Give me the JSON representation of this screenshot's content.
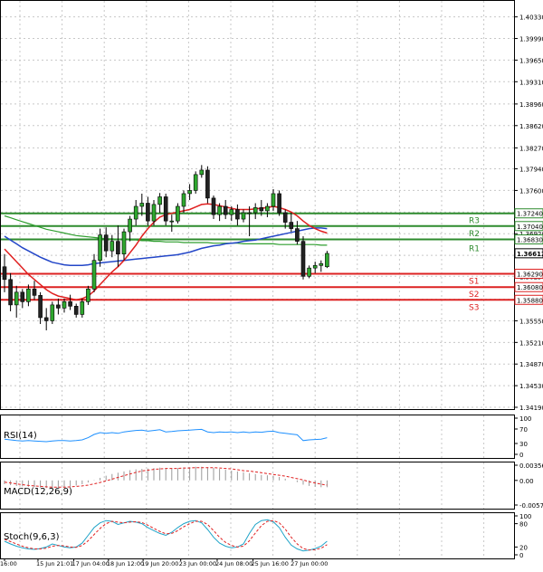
{
  "chart_data": {
    "type": "candlestick",
    "main_panel": {
      "price_axis_labels": [
        "1.40330",
        "1.39990",
        "1.39650",
        "1.39310",
        "1.38960",
        "1.38620",
        "1.38270",
        "1.37940",
        "1.37600",
        "1.37260",
        "1.36920",
        "1.36580",
        "1.36250",
        "1.35890",
        "1.35550",
        "1.35210",
        "1.34870",
        "1.34530",
        "1.34190"
      ],
      "price_axis_values": [
        1.4033,
        1.3999,
        1.3965,
        1.3931,
        1.3896,
        1.3862,
        1.3827,
        1.3794,
        1.376,
        1.3726,
        1.3692,
        1.3658,
        1.3625,
        1.3589,
        1.3555,
        1.3521,
        1.3487,
        1.3453,
        1.3419
      ],
      "ylim": [
        1.3419,
        1.4051
      ],
      "levels": [
        {
          "name": "R3",
          "value": 1.3724,
          "tag": "1.37240",
          "color": "#2e8b2e"
        },
        {
          "name": "R2",
          "value": 1.3704,
          "tag": "1.37040",
          "color": "#2e8b2e"
        },
        {
          "name": "",
          "value": 1.3683,
          "tag": "1.36830",
          "color": "#2e8b2e"
        },
        {
          "name": "R1",
          "value": 1.3683,
          "tag": "",
          "color": "#2e8b2e"
        },
        {
          "name": "S1",
          "value": 1.3629,
          "tag": "1.36290",
          "color": "#dd2222"
        },
        {
          "name": "S2",
          "value": 1.3608,
          "tag": "1.36080",
          "color": "#dd2222"
        },
        {
          "name": "S3",
          "value": 1.3588,
          "tag": "1.35880",
          "color": "#dd2222"
        }
      ],
      "current_price_tag": "1.36612",
      "current_price": 1.36612,
      "candles": [
        [
          1.364,
          1.366,
          1.36,
          1.362
        ],
        [
          1.362,
          1.363,
          1.357,
          1.358
        ],
        [
          1.358,
          1.361,
          1.356,
          1.36
        ],
        [
          1.36,
          1.3605,
          1.3575,
          1.3585
        ],
        [
          1.3585,
          1.3612,
          1.3578,
          1.3605
        ],
        [
          1.3605,
          1.3618,
          1.3588,
          1.3595
        ],
        [
          1.3595,
          1.36,
          1.355,
          1.356
        ],
        [
          1.356,
          1.3575,
          1.354,
          1.3555
        ],
        [
          1.3555,
          1.3585,
          1.355,
          1.358
        ],
        [
          1.358,
          1.359,
          1.3565,
          1.3575
        ],
        [
          1.3575,
          1.359,
          1.3568,
          1.3585
        ],
        [
          1.3585,
          1.3596,
          1.3572,
          1.3578
        ],
        [
          1.3578,
          1.3582,
          1.356,
          1.3565
        ],
        [
          1.3565,
          1.359,
          1.356,
          1.3585
        ],
        [
          1.3585,
          1.361,
          1.358,
          1.3605
        ],
        [
          1.3605,
          1.366,
          1.36,
          1.365
        ],
        [
          1.365,
          1.37,
          1.364,
          1.369
        ],
        [
          1.369,
          1.3702,
          1.3655,
          1.3665
        ],
        [
          1.3665,
          1.369,
          1.3655,
          1.368
        ],
        [
          1.368,
          1.3705,
          1.364,
          1.366
        ],
        [
          1.366,
          1.37,
          1.365,
          1.3695
        ],
        [
          1.3695,
          1.372,
          1.368,
          1.3715
        ],
        [
          1.3715,
          1.3745,
          1.3705,
          1.3735
        ],
        [
          1.3735,
          1.3755,
          1.372,
          1.374
        ],
        [
          1.374,
          1.375,
          1.3705,
          1.3712
        ],
        [
          1.3712,
          1.3745,
          1.3705,
          1.3738
        ],
        [
          1.3738,
          1.3756,
          1.3725,
          1.375
        ],
        [
          1.375,
          1.3755,
          1.3705,
          1.3712
        ],
        [
          1.3712,
          1.3722,
          1.3695,
          1.3712
        ],
        [
          1.3712,
          1.374,
          1.3708,
          1.3735
        ],
        [
          1.3735,
          1.376,
          1.3725,
          1.3755
        ],
        [
          1.3755,
          1.377,
          1.3745,
          1.376
        ],
        [
          1.376,
          1.379,
          1.3755,
          1.3785
        ],
        [
          1.3785,
          1.38,
          1.378,
          1.3792
        ],
        [
          1.3792,
          1.3798,
          1.374,
          1.3748
        ],
        [
          1.3748,
          1.3752,
          1.3715,
          1.3722
        ],
        [
          1.3722,
          1.374,
          1.3712,
          1.3735
        ],
        [
          1.3735,
          1.3745,
          1.3715,
          1.3722
        ],
        [
          1.3722,
          1.3735,
          1.3712,
          1.373
        ],
        [
          1.373,
          1.3738,
          1.3705,
          1.3715
        ],
        [
          1.3715,
          1.373,
          1.371,
          1.3725
        ],
        [
          1.3725,
          1.3735,
          1.3688,
          1.3725
        ],
        [
          1.3725,
          1.374,
          1.3715,
          1.3733
        ],
        [
          1.3733,
          1.3745,
          1.372,
          1.3728
        ],
        [
          1.3728,
          1.374,
          1.3718,
          1.3735
        ],
        [
          1.3735,
          1.3762,
          1.3728,
          1.3755
        ],
        [
          1.3755,
          1.376,
          1.372,
          1.3725
        ],
        [
          1.3725,
          1.373,
          1.37,
          1.371
        ],
        [
          1.371,
          1.3725,
          1.3695,
          1.37
        ],
        [
          1.37,
          1.3712,
          1.3675,
          1.368
        ],
        [
          1.368,
          1.3688,
          1.362,
          1.3625
        ],
        [
          1.3625,
          1.3642,
          1.3622,
          1.3638
        ],
        [
          1.3638,
          1.3648,
          1.363,
          1.3642
        ],
        [
          1.3642,
          1.365,
          1.3632,
          1.3645
        ],
        [
          1.364,
          1.3665,
          1.3638,
          1.3661
        ]
      ],
      "ma_red": [
        1.3668,
        1.3658,
        1.3648,
        1.3638,
        1.3628,
        1.362,
        1.3612,
        1.3604,
        1.3598,
        1.3594,
        1.3592,
        1.359,
        1.3588,
        1.359,
        1.3594,
        1.3602,
        1.3612,
        1.3622,
        1.3632,
        1.364,
        1.365,
        1.3662,
        1.3674,
        1.3688,
        1.37,
        1.371,
        1.3718,
        1.3722,
        1.3724,
        1.3726,
        1.3728,
        1.373,
        1.3734,
        1.3738,
        1.3739,
        1.3738,
        1.3736,
        1.3734,
        1.3732,
        1.373,
        1.373,
        1.373,
        1.3731,
        1.3732,
        1.3733,
        1.3735,
        1.3733,
        1.373,
        1.3726,
        1.372,
        1.3712,
        1.3705,
        1.37,
        1.3696,
        1.3693
      ],
      "ma_blue": [
        1.3688,
        1.3682,
        1.3676,
        1.367,
        1.3665,
        1.366,
        1.3655,
        1.3651,
        1.3647,
        1.3645,
        1.3643,
        1.3642,
        1.3642,
        1.3642,
        1.3643,
        1.3645,
        1.3646,
        1.3647,
        1.3648,
        1.3649,
        1.365,
        1.3651,
        1.3652,
        1.3653,
        1.3654,
        1.3655,
        1.3656,
        1.3657,
        1.3658,
        1.3659,
        1.3661,
        1.3663,
        1.3666,
        1.3669,
        1.3671,
        1.3673,
        1.3674,
        1.3676,
        1.3677,
        1.3678,
        1.368,
        1.3681,
        1.3682,
        1.3684,
        1.3686,
        1.3688,
        1.369,
        1.3692,
        1.3694,
        1.3696,
        1.3698,
        1.37,
        1.3701,
        1.3701,
        1.37
      ],
      "ma_green": [
        1.372,
        1.3717,
        1.3714,
        1.3711,
        1.3708,
        1.3705,
        1.3702,
        1.3699,
        1.3697,
        1.3695,
        1.3693,
        1.3691,
        1.3689,
        1.3688,
        1.3687,
        1.3686,
        1.3685,
        1.3684,
        1.3684,
        1.3683,
        1.3683,
        1.3682,
        1.3682,
        1.3681,
        1.3681,
        1.368,
        1.368,
        1.3679,
        1.3679,
        1.3679,
        1.3678,
        1.3678,
        1.3678,
        1.3678,
        1.3678,
        1.3677,
        1.3677,
        1.3677,
        1.3677,
        1.3677,
        1.3676,
        1.3676,
        1.3676,
        1.3676,
        1.3676,
        1.3676,
        1.3675,
        1.3675,
        1.3675,
        1.3675,
        1.3675,
        1.3675,
        1.3675,
        1.3674,
        1.3674
      ]
    },
    "time_axis_labels": [
      "16:00",
      "15 Jun 21:01",
      "17 Jun 04:00",
      "18 Jun 12:00",
      "19 Jun 20:00",
      "23 Jun 00:00",
      "24 Jun 08:00",
      "25 Jun 16:00",
      "27 Jun 00:00"
    ],
    "time_axis_index": [
      0,
      5.6,
      11.6,
      17.4,
      23.2,
      29.5,
      35.6,
      41.6,
      48.2
    ],
    "rsi_panel": {
      "label": "RSI(14)",
      "axis_labels": [
        "100",
        "70",
        "30",
        "0"
      ],
      "axis_values": [
        100,
        70,
        30,
        0
      ],
      "ylim": [
        0,
        100
      ],
      "values": [
        42,
        40,
        38,
        37,
        38,
        37,
        36,
        35,
        37,
        38,
        38,
        37,
        38,
        40,
        46,
        55,
        60,
        58,
        60,
        58,
        62,
        64,
        66,
        67,
        64,
        66,
        68,
        62,
        63,
        65,
        66,
        67,
        68,
        69,
        62,
        60,
        62,
        61,
        62,
        60,
        62,
        60,
        62,
        61,
        63,
        64,
        60,
        58,
        56,
        54,
        38,
        40,
        41,
        42,
        46
      ]
    },
    "macd_panel": {
      "label": "MACD(12,26,9)",
      "axis_labels": [
        "0.003568",
        "0.00",
        "-0.00578"
      ],
      "axis_values": [
        0.003568,
        0,
        -0.00578
      ],
      "ylim": [
        -0.00578,
        0.003568
      ],
      "histogram": [
        -0.0009,
        -0.0011,
        -0.0013,
        -0.0014,
        -0.0015,
        -0.0016,
        -0.0017,
        -0.0018,
        -0.0018,
        -0.0017,
        -0.0016,
        -0.0014,
        -0.0012,
        -0.0009,
        -0.0005,
        0.0001,
        0.0006,
        0.0011,
        0.0015,
        0.0018,
        0.0021,
        0.0024,
        0.0026,
        0.0027,
        0.0028,
        0.0029,
        0.003,
        0.0029,
        0.0029,
        0.0029,
        0.003,
        0.0031,
        0.0032,
        0.0032,
        0.0031,
        0.0029,
        0.0027,
        0.0025,
        0.0023,
        0.0021,
        0.0019,
        0.0017,
        0.0015,
        0.0013,
        0.0012,
        0.0011,
        0.0008,
        0.0004,
        0.0,
        -0.0004,
        -0.001,
        -0.0013,
        -0.0015,
        -0.0016,
        -0.0016
      ],
      "signal": [
        -0.0004,
        -0.0006,
        -0.0008,
        -0.001,
        -0.0012,
        -0.0013,
        -0.0014,
        -0.0015,
        -0.0016,
        -0.0016,
        -0.0016,
        -0.0015,
        -0.0014,
        -0.0013,
        -0.0011,
        -0.0008,
        -0.0005,
        -0.0001,
        0.0003,
        0.0007,
        0.0011,
        0.0015,
        0.0019,
        0.0022,
        0.0024,
        0.0026,
        0.0027,
        0.0028,
        0.0028,
        0.0028,
        0.0029,
        0.0029,
        0.003,
        0.003,
        0.003,
        0.003,
        0.0029,
        0.0028,
        0.0027,
        0.0025,
        0.0023,
        0.0022,
        0.002,
        0.0018,
        0.0016,
        0.0014,
        0.0012,
        0.001,
        0.0007,
        0.0004,
        0.0001,
        -0.0003,
        -0.0006,
        -0.0009,
        -0.0011
      ]
    },
    "stoch_panel": {
      "label": "Stoch(9,6,3)",
      "axis_labels": [
        "100",
        "80",
        "20",
        "0"
      ],
      "axis_values": [
        100,
        80,
        20,
        0
      ],
      "ylim": [
        0,
        100
      ],
      "main": [
        35,
        28,
        22,
        18,
        15,
        14,
        16,
        20,
        28,
        24,
        20,
        18,
        20,
        30,
        50,
        70,
        82,
        88,
        86,
        78,
        82,
        86,
        84,
        80,
        70,
        62,
        55,
        50,
        58,
        70,
        80,
        86,
        88,
        82,
        65,
        45,
        30,
        22,
        18,
        20,
        28,
        55,
        78,
        88,
        90,
        85,
        70,
        45,
        25,
        15,
        10,
        12,
        16,
        22,
        35
      ],
      "signal": [
        40,
        34,
        28,
        22,
        18,
        15,
        15,
        17,
        22,
        24,
        23,
        20,
        19,
        24,
        36,
        52,
        68,
        80,
        86,
        84,
        82,
        84,
        85,
        83,
        76,
        68,
        60,
        54,
        55,
        62,
        72,
        80,
        86,
        86,
        78,
        62,
        45,
        32,
        24,
        20,
        22,
        36,
        56,
        75,
        86,
        88,
        82,
        66,
        45,
        28,
        16,
        12,
        13,
        17,
        26
      ]
    }
  }
}
